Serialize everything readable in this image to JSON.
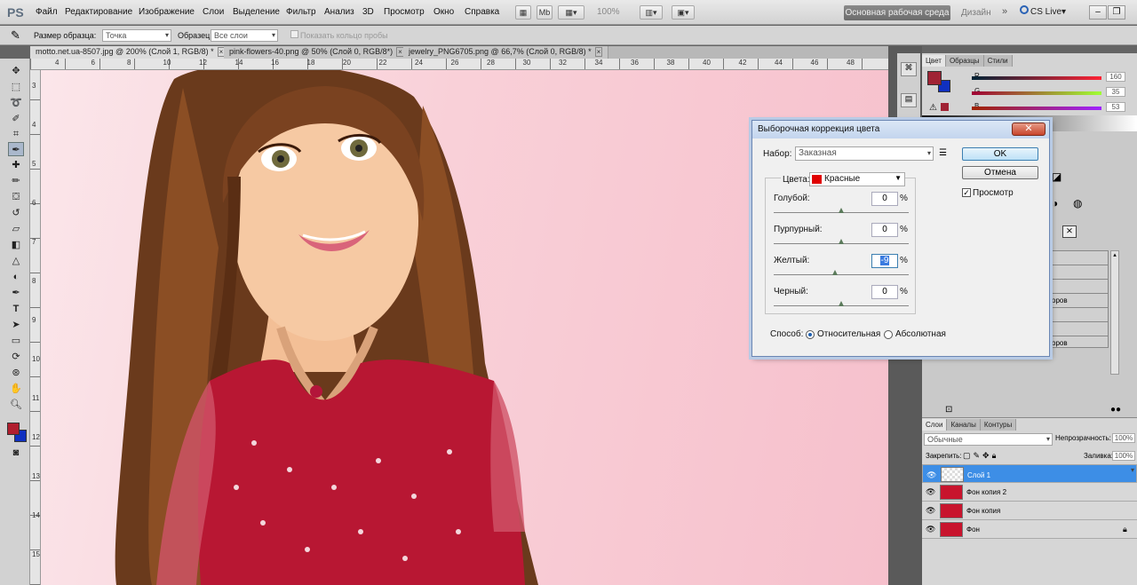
{
  "app": {
    "logo": "PS"
  },
  "menu": [
    "Файл",
    "Редактирование",
    "Изображение",
    "Слои",
    "Выделение",
    "Фильтр",
    "Анализ",
    "3D",
    "Просмотр",
    "Окно",
    "Справка"
  ],
  "menubar": {
    "zoom": "100%",
    "workspace": "Основная рабочая среда",
    "design": "Дизайн",
    "cslive": "CS Live▾"
  },
  "options": {
    "sample_size_label": "Размер образца:",
    "sample_size_value": "Точка",
    "sample_label": "Образец:",
    "sample_value": "Все слои",
    "ring_label": "Показать кольцо пробы"
  },
  "tabs": [
    {
      "label": "motto.net.ua-8507.jpg @ 200% (Слой 1, RGB/8) *"
    },
    {
      "label": "pink-flowers-40.png @ 50% (Слой 0, RGB/8*)"
    },
    {
      "label": "jewelry_PNG6705.png @ 66,7% (Слой 0, RGB/8) *"
    }
  ],
  "ruler_top": [
    "4",
    "6",
    "8",
    "10",
    "12",
    "14",
    "16",
    "18",
    "20",
    "22",
    "24",
    "26",
    "28",
    "30",
    "32",
    "34",
    "36",
    "38",
    "40",
    "42",
    "44",
    "46",
    "48"
  ],
  "ruler_left": [
    "3",
    "4",
    "5",
    "6",
    "7",
    "8",
    "9",
    "10",
    "11",
    "12",
    "13",
    "14",
    "15"
  ],
  "color_panel": {
    "tabs": [
      "Цвет",
      "Образцы",
      "Стили"
    ],
    "r_label": "R",
    "r_value": "160",
    "g_label": "G",
    "g_value": "35",
    "b_label": "B",
    "b_value": "53",
    "fg_color": "#a02335",
    "bg_color": "#1030c0"
  },
  "mid_panel_rows": [
    "оров",
    "оров"
  ],
  "layers_panel": {
    "tabs": [
      "Слои",
      "Каналы",
      "Контуры"
    ],
    "blend_mode": "Обычные",
    "opacity_label": "Непрозрачность:",
    "opacity_value": "100%",
    "lock_label": "Закрепить:",
    "fill_label": "Заливка:",
    "fill_value": "100%",
    "layers": [
      {
        "name": "Слой 1",
        "selected": true
      },
      {
        "name": "Фон копия 2",
        "selected": false
      },
      {
        "name": "Фон копия",
        "selected": false
      },
      {
        "name": "Фон",
        "selected": false
      }
    ]
  },
  "dialog": {
    "title": "Выборочная коррекция цвета",
    "preset_label": "Набор:",
    "preset_value": "Заказная",
    "ok": "OK",
    "cancel": "Отмена",
    "preview": "Просмотр",
    "colors_label": "Цвета:",
    "colors_value": "Красные",
    "colors_swatch": "#e00000",
    "sliders": [
      {
        "label": "Голубой:",
        "value": "0",
        "unit": "%"
      },
      {
        "label": "Пурпурный:",
        "value": "0",
        "unit": "%"
      },
      {
        "label": "Желтый:",
        "value": "-9",
        "unit": "%"
      },
      {
        "label": "Черный:",
        "value": "0",
        "unit": "%"
      }
    ],
    "method_label": "Способ:",
    "method_relative": "Относительная",
    "method_absolute": "Абсолютная"
  }
}
